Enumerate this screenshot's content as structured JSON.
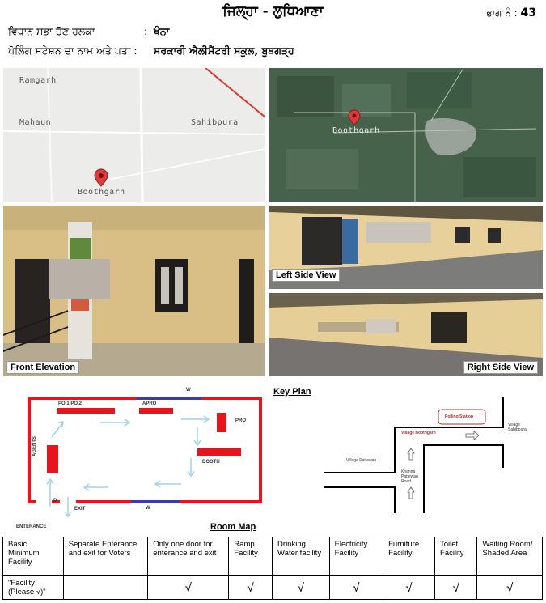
{
  "header": {
    "title": "ਜਿਲ੍ਹਾ - ਲੁਧਿਆਣਾ",
    "part_label": "ਭਾਗ ਨੰ :",
    "part_no": "43",
    "constituency_label": "ਵਿਧਾਨ ਸਭਾ ਚੋਣ ਹਲਕਾ",
    "constituency_sep": ":",
    "constituency_value": "ਖੰਨਾ",
    "station_label": "ਪੋਲਿੰਗ ਸਟੇਸ਼ਨ ਦਾ ਨਾਮ ਅਤੇ ਪਤਾ :",
    "station_value": "ਸਰਕਾਰੀ ਐਲੀਮੈਂਟਰੀ ਸਕੂਲ, ਬੂਥਗੜ੍ਹ"
  },
  "road_map": {
    "labels": [
      "Ramgarh",
      "Mahaun",
      "Sahibpura",
      "Boothgarh"
    ]
  },
  "satellite_map": {
    "label": "Boothgarh"
  },
  "photos": {
    "front": "Front Elevation",
    "left": "Left Side View",
    "right": "Right Side View"
  },
  "room_map": {
    "title": "Room Map",
    "labels": {
      "po": "PO.1  PO.2",
      "apro": "APRO",
      "pro": "PRO",
      "booth": "BOOTH",
      "agents": "AGENTS",
      "w_top": "W",
      "w_bottom": "W",
      "d": "D",
      "exit": "EXIT",
      "entrance": "ENTERANCE"
    }
  },
  "key_plan": {
    "title": "Key Plan",
    "labels": {
      "polling_station": "Polling Station",
      "village_boothgarh": "Village Boothgarh",
      "village_sahibpura": "Village Sahibpura",
      "village_pattewan": "Village Pattewan",
      "road": "Khanna Pattewan Road"
    }
  },
  "facilities": {
    "headers": [
      "Basic Minimum Facility",
      "Separate Enterance and exit for Voters",
      "Only one door for enterance and exit",
      "Ramp Facility",
      "Drinking Water facility",
      "Electricity Facility",
      "Furniture Facility",
      "Toilet Facility",
      "Waiting Room/ Shaded Area"
    ],
    "row_label": "\"Facility (Please √)\"",
    "cells": [
      "",
      "√",
      "√",
      "√",
      "√",
      "√",
      "√",
      "√"
    ]
  },
  "colors": {
    "plan_red": "#e8141b",
    "plan_blue": "#3a3aa8",
    "arrow": "#9fd3e8",
    "map_pin": "#e03b3b"
  }
}
